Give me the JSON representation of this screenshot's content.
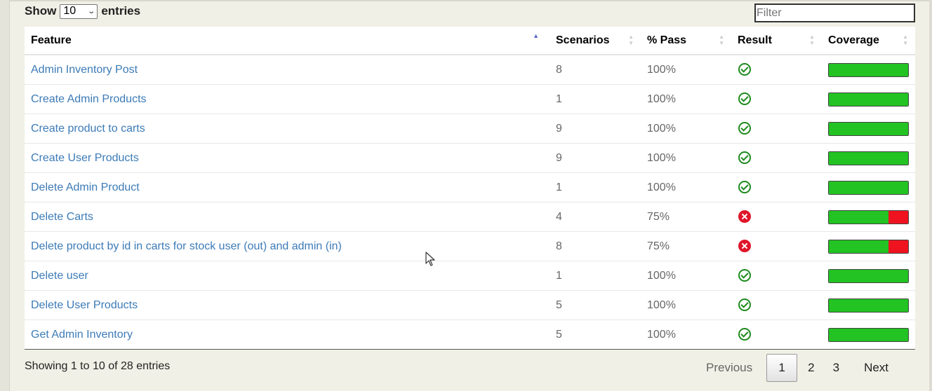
{
  "length_control": {
    "prefix": "Show",
    "selected": "10",
    "suffix": "entries"
  },
  "filter": {
    "placeholder": "Filter"
  },
  "table": {
    "headers": {
      "feature": "Feature",
      "scenarios": "Scenarios",
      "pass": "% Pass",
      "result": "Result",
      "coverage": "Coverage"
    },
    "sorted_column": "feature",
    "sort_direction": "ascending",
    "rows": [
      {
        "feature": "Admin Inventory Post",
        "scenarios": "8",
        "pass": "100%",
        "result": "passed",
        "coverage_pass": 1.0
      },
      {
        "feature": "Create Admin Products",
        "scenarios": "1",
        "pass": "100%",
        "result": "passed",
        "coverage_pass": 1.0
      },
      {
        "feature": "Create product to carts",
        "scenarios": "9",
        "pass": "100%",
        "result": "passed",
        "coverage_pass": 1.0
      },
      {
        "feature": "Create User Products",
        "scenarios": "9",
        "pass": "100%",
        "result": "passed",
        "coverage_pass": 1.0
      },
      {
        "feature": "Delete Admin Product",
        "scenarios": "1",
        "pass": "100%",
        "result": "passed",
        "coverage_pass": 1.0
      },
      {
        "feature": "Delete Carts",
        "scenarios": "4",
        "pass": "75%",
        "result": "failed",
        "coverage_pass": 0.75
      },
      {
        "feature": "Delete product by id in carts for stock user (out) and admin (in)",
        "scenarios": "8",
        "pass": "75%",
        "result": "failed",
        "coverage_pass": 0.75
      },
      {
        "feature": "Delete user",
        "scenarios": "1",
        "pass": "100%",
        "result": "passed",
        "coverage_pass": 1.0
      },
      {
        "feature": "Delete User Products",
        "scenarios": "5",
        "pass": "100%",
        "result": "passed",
        "coverage_pass": 1.0
      },
      {
        "feature": "Get Admin Inventory",
        "scenarios": "5",
        "pass": "100%",
        "result": "passed",
        "coverage_pass": 1.0
      }
    ]
  },
  "info": "Showing 1 to 10 of 28 entries",
  "pagination": {
    "previous": "Previous",
    "pages": [
      "1",
      "2",
      "3"
    ],
    "current": "1",
    "next": "Next"
  },
  "colors": {
    "link": "#3c7bb7",
    "pass_green": "#22c322",
    "fail_red": "#ef1320",
    "check_green": "#1e8a1e",
    "background": "#f0f0e6"
  }
}
